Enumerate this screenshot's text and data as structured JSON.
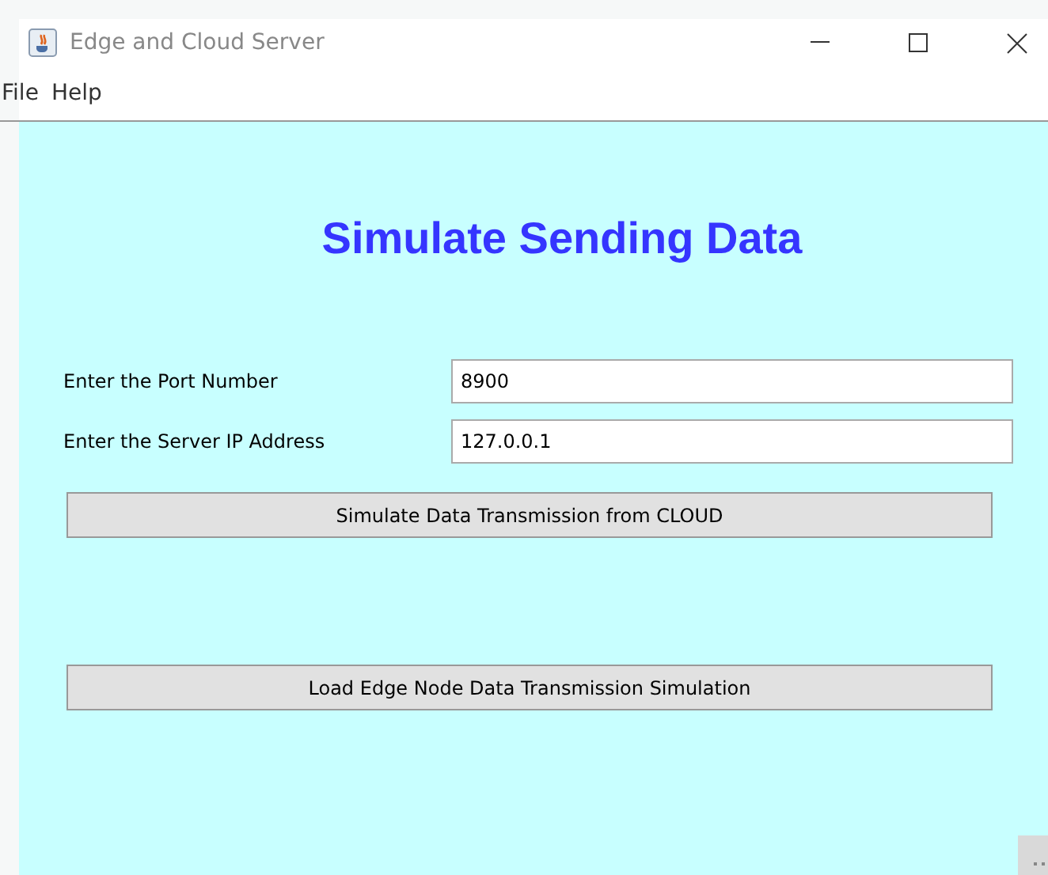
{
  "window": {
    "title": "Edge and Cloud Server"
  },
  "menu": [
    "File",
    "Help"
  ],
  "heading": "Simulate Sending Data",
  "fields": [
    {
      "label": "Enter the Port Number",
      "value": "8900"
    },
    {
      "label": "Enter the Server IP Address",
      "value": "127.0.0.1"
    }
  ],
  "buttons": [
    "Simulate Data Transmission from CLOUD",
    "Load Edge Node Data Transmission Simulation"
  ]
}
